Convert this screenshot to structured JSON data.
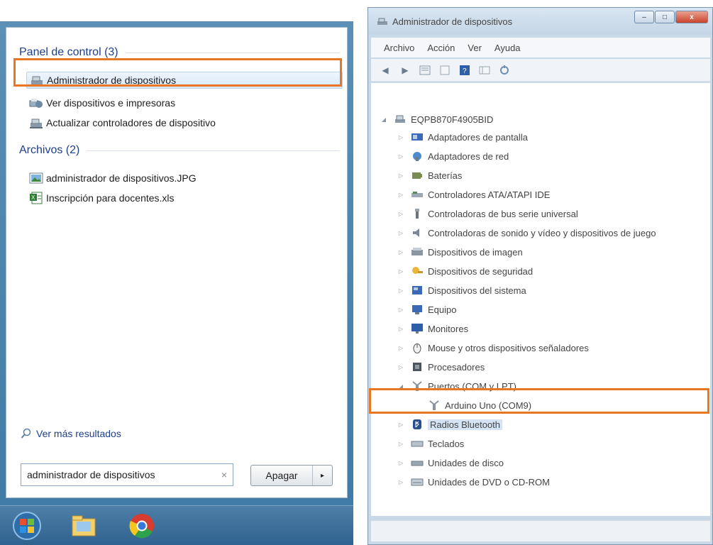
{
  "start_menu": {
    "groups": [
      {
        "header": "Panel de control (3)",
        "items": [
          {
            "label": "Administrador de dispositivos",
            "icon": "device-manager-icon"
          },
          {
            "label": "Ver dispositivos e impresoras",
            "icon": "devices-printers-icon"
          },
          {
            "label": "Actualizar controladores de dispositivo",
            "icon": "device-manager-icon"
          }
        ]
      },
      {
        "header": "Archivos (2)",
        "items": [
          {
            "label": "administrador de dispositivos.JPG",
            "icon": "image-file-icon"
          },
          {
            "label": "Inscripción para docentes.xls",
            "icon": "excel-file-icon"
          }
        ]
      }
    ],
    "more_results": "Ver más resultados",
    "search": {
      "value": "administrador de dispositivos",
      "clear": "×"
    },
    "shutdown": {
      "label": "Apagar",
      "arrow": "▸"
    },
    "taskbar": [
      {
        "name": "start-orb-icon"
      },
      {
        "name": "explorer-icon"
      },
      {
        "name": "chrome-icon"
      }
    ]
  },
  "device_manager": {
    "title": "Administrador de dispositivos",
    "window_buttons": {
      "minimize": "–",
      "maximize": "□",
      "close": "x"
    },
    "menu": [
      "Archivo",
      "Acción",
      "Ver",
      "Ayuda"
    ],
    "toolbar_icons": [
      "back-icon",
      "forward-icon",
      "properties-icon",
      "refresh-icon",
      "help-icon",
      "view-icon",
      "scan-icon"
    ],
    "root": "EQPB870F4905BID",
    "nodes": [
      "Adaptadores de pantalla",
      "Adaptadores de red",
      "Baterías",
      "Controladores ATA/ATAPI IDE",
      "Controladoras de bus serie universal",
      "Controladoras de sonido y vídeo y dispositivos de juego",
      "Dispositivos de imagen",
      "Dispositivos de seguridad",
      "Dispositivos del sistema",
      "Equipo",
      "Monitores",
      "Mouse y otros dispositivos señaladores",
      "Procesadores",
      "Puertos (COM y LPT)"
    ],
    "child": "Arduino Uno (COM9)",
    "nodes_after": [
      "Radios Bluetooth",
      "Teclados",
      "Unidades de disco",
      "Unidades de DVD o CD-ROM"
    ]
  }
}
